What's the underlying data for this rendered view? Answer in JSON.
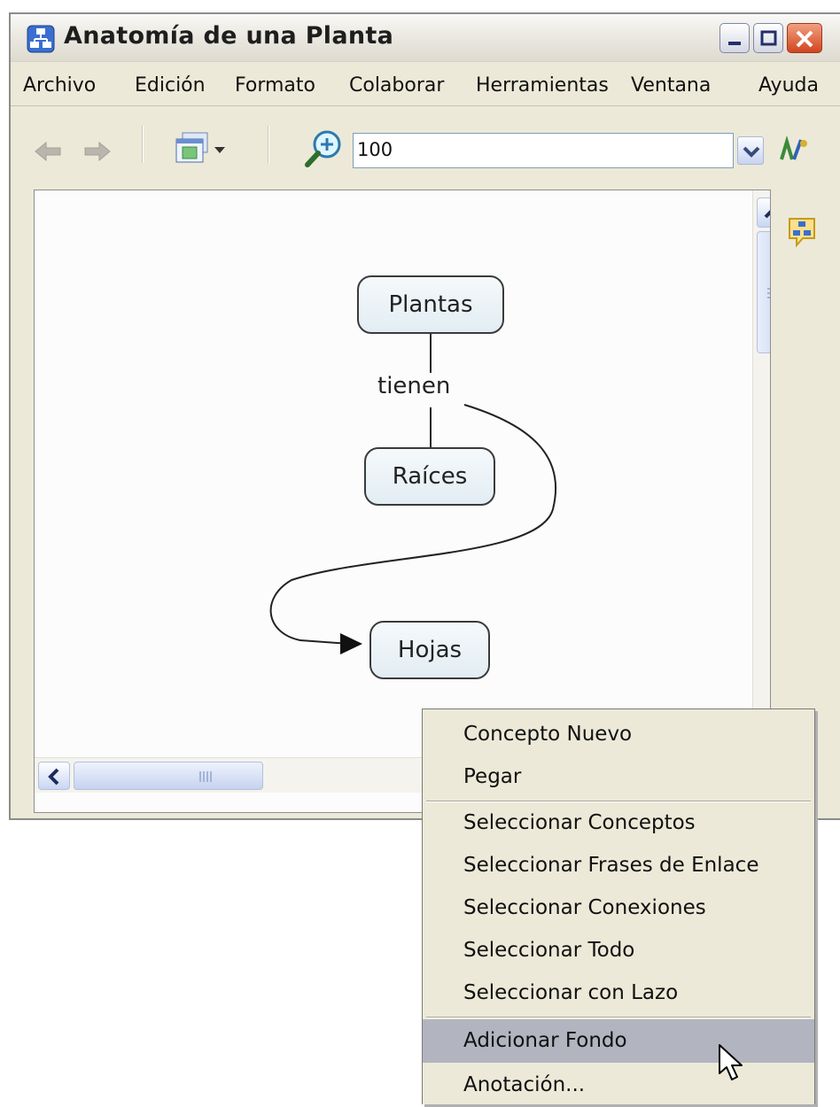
{
  "window": {
    "title": "Anatomía de una Planta"
  },
  "menubar": {
    "items": [
      "Archivo",
      "Edición",
      "Formato",
      "Colaborar",
      "Herramientas",
      "Ventana",
      "Ayuda"
    ]
  },
  "toolbar": {
    "back_icon": "back-arrow-icon",
    "forward_icon": "forward-arrow-icon",
    "view_icon": "view-window-icon",
    "zoom_icon": "zoom-in-icon",
    "zoom_value": "100",
    "style_icon": "styles-icon"
  },
  "concept_map": {
    "concepts": [
      "Plantas",
      "Raíces",
      "Hojas"
    ],
    "linking_phrase": "tienen",
    "connections": [
      {
        "from": "Plantas",
        "via": "tienen",
        "to": "Raíces"
      },
      {
        "from": "Plantas",
        "via": "tienen",
        "to": "Hojas"
      }
    ]
  },
  "context_menu": {
    "items": [
      "Concepto Nuevo",
      "Pegar",
      "Seleccionar Conceptos",
      "Seleccionar Frases de Enlace",
      "Seleccionar Conexiones",
      "Seleccionar Todo",
      "Seleccionar con Lazo",
      "Adicionar Fondo",
      "Anotación..."
    ],
    "highlighted": "Adicionar Fondo"
  },
  "colors": {
    "window_bg": "#ece9d8",
    "menu_highlight": "#b2b4bf",
    "concept_fill": "#e2edf3",
    "close_button": "#d2451f"
  }
}
